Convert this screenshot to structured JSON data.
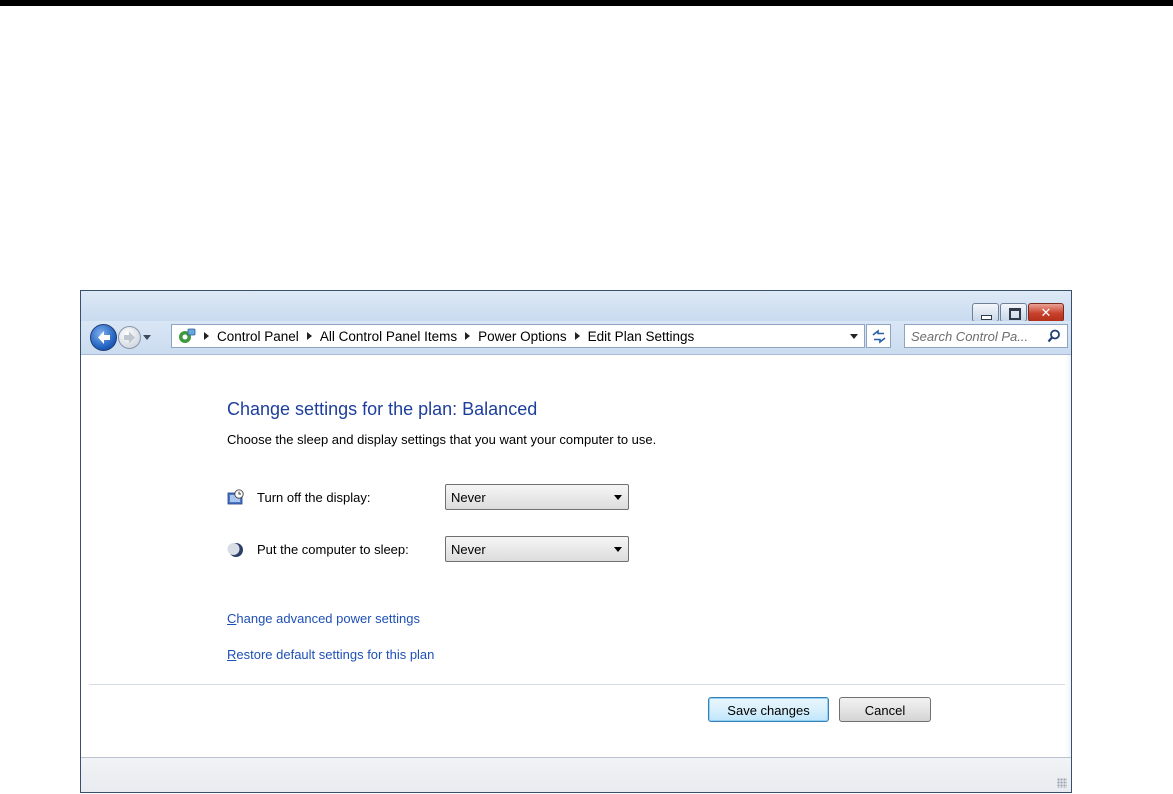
{
  "window": {
    "breadcrumb": [
      "Control Panel",
      "All Control Panel Items",
      "Power Options",
      "Edit Plan Settings"
    ],
    "search_placeholder": "Search Control Pa..."
  },
  "page": {
    "title": "Change settings for the plan: Balanced",
    "subtitle": "Choose the sleep and display settings that you want your computer to use."
  },
  "settings": {
    "display": {
      "label": "Turn off the display:",
      "value": "Never",
      "icon": "monitor-clock-icon"
    },
    "sleep": {
      "label": "Put the computer to sleep:",
      "value": "Never",
      "icon": "moon-icon"
    }
  },
  "links": {
    "advanced": {
      "hotkey": "C",
      "rest": "hange advanced power settings"
    },
    "restore": {
      "hotkey": "R",
      "rest": "estore default settings for this plan"
    }
  },
  "buttons": {
    "save": "Save changes",
    "cancel": "Cancel"
  },
  "colors": {
    "heading": "#1e3e9d",
    "link": "#1e50b5",
    "close_button": "#c8412c"
  }
}
